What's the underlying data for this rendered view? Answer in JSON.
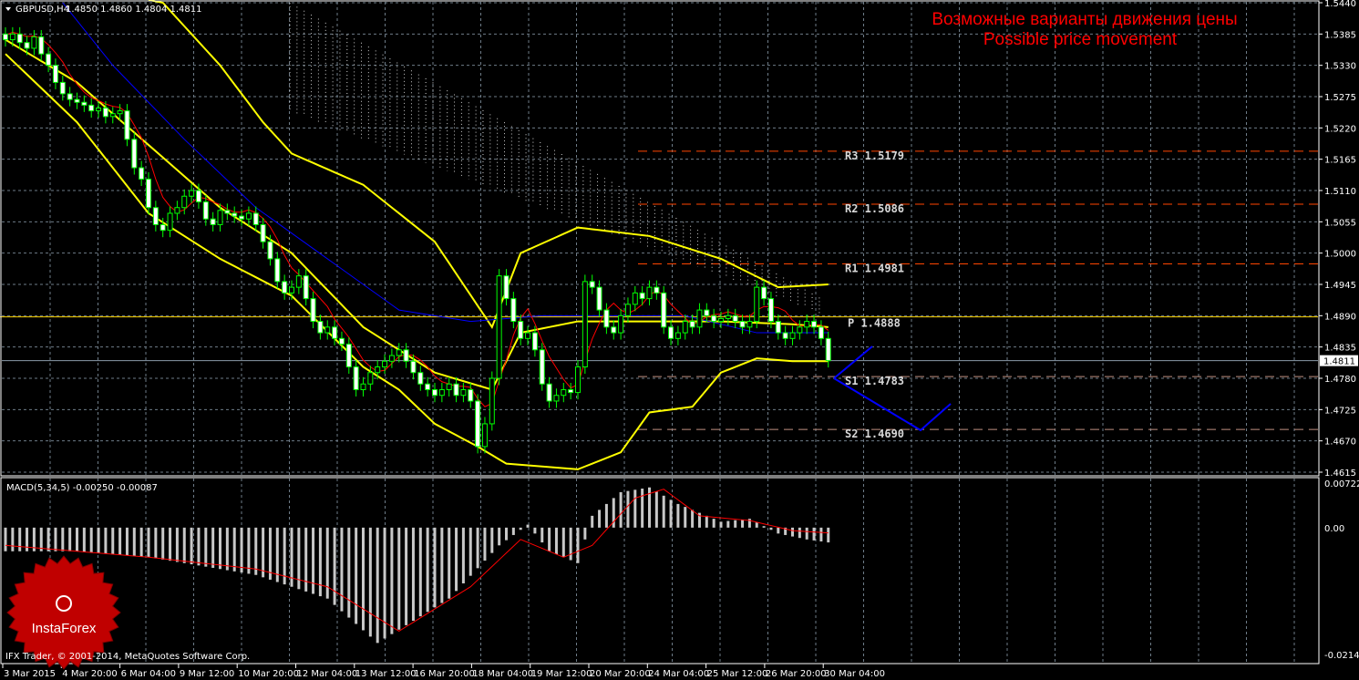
{
  "header": {
    "symbol_label": "GBPUSD,H4",
    "ohlc": "1.4850 1.4860 1.4804 1.4811"
  },
  "annotation": {
    "line1": "Возможные варианты движения цены",
    "line2": "Possible price movement"
  },
  "copyright": "IFX Trader, © 2001-2014, MetaQuotes Software Corp.",
  "logo": {
    "text": "InstaForex",
    "color": "#c00000"
  },
  "macd": {
    "label": "MACD(5,34,5) -0.00250 -0.00087"
  },
  "colors": {
    "bull": "#00ff00",
    "body_up": "#000000",
    "body_down": "#ffffff",
    "bands": "#ffff00",
    "ma_fast": "#ff0000",
    "ma_slow": "#0000ff",
    "pivot": "#ff4500",
    "forecast": "#0000ff",
    "grid": "#8a9aa8"
  },
  "pivots": [
    {
      "name": "R3",
      "label": "R3  1.5179",
      "value": 1.5179
    },
    {
      "name": "R2",
      "label": "R2  1.5086",
      "value": 1.5086
    },
    {
      "name": "R1",
      "label": "R1  1.4981",
      "value": 1.4981
    },
    {
      "name": "P",
      "label": "P  1.4888",
      "value": 1.4888
    },
    {
      "name": "S1",
      "label": "S1  1.4783",
      "value": 1.4783
    },
    {
      "name": "S2",
      "label": "S2  1.4690",
      "value": 1.469
    }
  ],
  "chart_data": [
    {
      "type": "candlestick",
      "title": "GBPUSD,H4",
      "ylim": [
        1.4615,
        1.544
      ],
      "y_ticks": [
        "1.5440",
        "1.5385",
        "1.5330",
        "1.5275",
        "1.5220",
        "1.5165",
        "1.5110",
        "1.5055",
        "1.5000",
        "1.4945",
        "1.4890",
        "1.4835",
        "1.4780",
        "1.4725",
        "1.4670",
        "1.4615"
      ],
      "current_price": "1.4811",
      "x_ticks": [
        "3 Mar 2015",
        "4 Mar 20:00",
        "6 Mar 04:00",
        "9 Mar 12:00",
        "10 Mar 20:00",
        "12 Mar 04:00",
        "13 Mar 12:00",
        "16 Mar 20:00",
        "18 Mar 04:00",
        "19 Mar 12:00",
        "20 Mar 20:00",
        "24 Mar 04:00",
        "25 Mar 12:00",
        "26 Mar 20:00",
        "30 Mar 04:00"
      ],
      "closes": [
        1.5375,
        1.5385,
        1.537,
        1.536,
        1.538,
        1.535,
        1.533,
        1.53,
        1.528,
        1.527,
        1.5265,
        1.526,
        1.525,
        1.5255,
        1.524,
        1.5245,
        1.525,
        1.52,
        1.515,
        1.513,
        1.508,
        1.505,
        1.504,
        1.507,
        1.508,
        1.51,
        1.511,
        1.509,
        1.506,
        1.505,
        1.5075,
        1.507,
        1.5065,
        1.506,
        1.507,
        1.505,
        1.502,
        1.499,
        1.495,
        1.493,
        1.494,
        1.496,
        1.492,
        1.488,
        1.486,
        1.487,
        1.485,
        1.484,
        1.48,
        1.476,
        1.477,
        1.479,
        1.48,
        1.481,
        1.482,
        1.483,
        1.481,
        1.479,
        1.477,
        1.476,
        1.475,
        1.476,
        1.477,
        1.475,
        1.476,
        1.474,
        1.466,
        1.47,
        1.478,
        1.496,
        1.492,
        1.488,
        1.485,
        1.486,
        1.483,
        1.477,
        1.474,
        1.475,
        1.476,
        1.4755,
        1.48,
        1.495,
        1.494,
        1.49,
        1.487,
        1.486,
        1.489,
        1.491,
        1.493,
        1.492,
        1.494,
        1.493,
        1.487,
        1.485,
        1.486,
        1.488,
        1.487,
        1.49,
        1.489,
        1.488,
        1.4885,
        1.489,
        1.488,
        1.487,
        1.488,
        1.494,
        1.492,
        1.488,
        1.486,
        1.485,
        1.486,
        1.487,
        1.488,
        1.487,
        1.485,
        1.4811
      ],
      "bands": {
        "upper": [
          [
            20,
            1.5445
          ],
          [
            22,
            1.544
          ],
          [
            30,
            1.533
          ],
          [
            36,
            1.523
          ],
          [
            40,
            1.5175
          ],
          [
            50,
            1.512
          ],
          [
            60,
            1.502
          ],
          [
            68,
            1.487
          ],
          [
            72,
            1.5
          ],
          [
            80,
            1.5045
          ],
          [
            90,
            1.503
          ],
          [
            100,
            1.499
          ],
          [
            108,
            1.494
          ],
          [
            115,
            1.4945
          ]
        ],
        "middle": [
          [
            0,
            1.5375
          ],
          [
            10,
            1.53
          ],
          [
            20,
            1.519
          ],
          [
            30,
            1.508
          ],
          [
            40,
            1.5
          ],
          [
            50,
            1.487
          ],
          [
            60,
            1.479
          ],
          [
            68,
            1.476
          ],
          [
            72,
            1.486
          ],
          [
            80,
            1.488
          ],
          [
            90,
            1.488
          ],
          [
            100,
            1.488
          ],
          [
            110,
            1.4875
          ],
          [
            115,
            1.487
          ]
        ],
        "lower": [
          [
            0,
            1.535
          ],
          [
            10,
            1.523
          ],
          [
            20,
            1.507
          ],
          [
            30,
            1.499
          ],
          [
            40,
            1.4925
          ],
          [
            50,
            1.48
          ],
          [
            55,
            1.476
          ],
          [
            60,
            1.47
          ],
          [
            66,
            1.466
          ],
          [
            70,
            1.463
          ],
          [
            80,
            1.462
          ],
          [
            86,
            1.465
          ],
          [
            90,
            1.472
          ],
          [
            96,
            1.473
          ],
          [
            100,
            1.479
          ],
          [
            105,
            1.4815
          ],
          [
            110,
            1.481
          ],
          [
            115,
            1.481
          ]
        ]
      },
      "ma_slow": [
        [
          8,
          1.544
        ],
        [
          15,
          1.533
        ],
        [
          25,
          1.52
        ],
        [
          35,
          1.508
        ],
        [
          45,
          1.499
        ],
        [
          55,
          1.49
        ],
        [
          65,
          1.488
        ],
        [
          75,
          1.489
        ],
        [
          85,
          1.489
        ],
        [
          95,
          1.489
        ],
        [
          105,
          1.486
        ],
        [
          115,
          1.486
        ]
      ]
    },
    {
      "type": "bar",
      "title": "MACD(5,34,5)",
      "ylim": [
        -0.02145,
        0.00722
      ],
      "y_ticks": [
        "0.00722",
        "0.00",
        "-0.02145"
      ],
      "histogram_keypoints": [
        [
          0,
          -0.004
        ],
        [
          10,
          -0.004
        ],
        [
          20,
          -0.005
        ],
        [
          35,
          -0.008
        ],
        [
          45,
          -0.012
        ],
        [
          52,
          -0.0195
        ],
        [
          62,
          -0.012
        ],
        [
          69,
          -0.003
        ],
        [
          73,
          0.0005
        ],
        [
          76,
          -0.004
        ],
        [
          80,
          -0.006
        ],
        [
          82,
          0.002
        ],
        [
          86,
          0.006
        ],
        [
          90,
          0.0068
        ],
        [
          94,
          0.004
        ],
        [
          100,
          0.001
        ],
        [
          104,
          0.0015
        ],
        [
          108,
          -0.001
        ],
        [
          112,
          -0.002
        ],
        [
          115,
          -0.0025
        ]
      ],
      "signal_keypoints": [
        [
          0,
          -0.003
        ],
        [
          20,
          -0.005
        ],
        [
          35,
          -0.007
        ],
        [
          45,
          -0.01
        ],
        [
          55,
          -0.0175
        ],
        [
          65,
          -0.01
        ],
        [
          72,
          -0.002
        ],
        [
          78,
          -0.005
        ],
        [
          82,
          -0.003
        ],
        [
          88,
          0.005
        ],
        [
          92,
          0.0065
        ],
        [
          97,
          0.002
        ],
        [
          104,
          0.0012
        ],
        [
          110,
          -0.0005
        ],
        [
          115,
          -0.0009
        ]
      ]
    }
  ]
}
